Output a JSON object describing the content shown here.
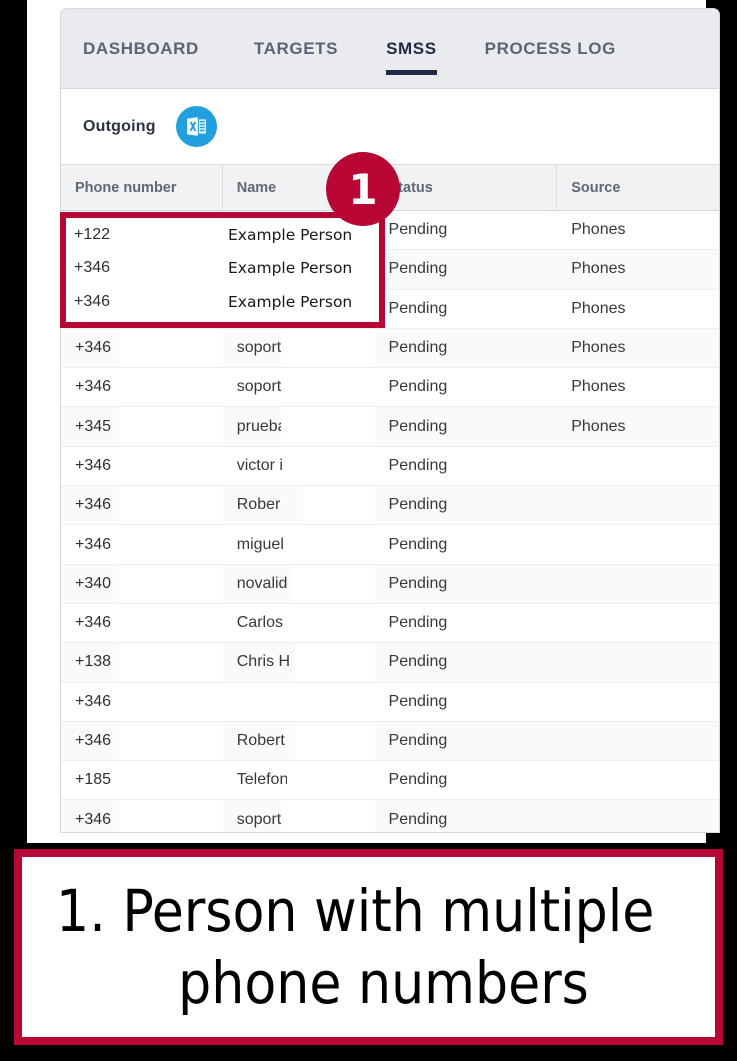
{
  "window": {
    "outer_background": "#000000",
    "page_background": "#ffffff",
    "accent_red": "#b80735",
    "excel_blue": "#21a0dd"
  },
  "tabs": [
    {
      "label": "DASHBOARD",
      "active": false
    },
    {
      "label": "TARGETS",
      "active": false
    },
    {
      "label": "SMSS",
      "active": true
    },
    {
      "label": "PROCESS LOG",
      "active": false
    }
  ],
  "toolbar": {
    "title": "Outgoing",
    "export_icon": "excel-export-icon"
  },
  "table": {
    "columns": [
      "Phone number",
      "Name",
      "Status",
      "Source"
    ],
    "rows": [
      {
        "phone": "+122",
        "name": "",
        "status": "Pending",
        "source": "Phones"
      },
      {
        "phone": "+346",
        "name": "",
        "status": "Pending",
        "source": "Phones"
      },
      {
        "phone": "+346",
        "name": "",
        "status": "Pending",
        "source": "Phones"
      },
      {
        "phone": "+346",
        "name": "soport",
        "status": "Pending",
        "source": "Phones"
      },
      {
        "phone": "+346",
        "name": "soport",
        "status": "Pending",
        "source": "Phones"
      },
      {
        "phone": "+345",
        "name": "prueba",
        "status": "Pending",
        "source": "Phones"
      },
      {
        "phone": "+346",
        "name": "victor i",
        "status": "Pending",
        "source": ""
      },
      {
        "phone": "+346",
        "name": "Rober",
        "status": "Pending",
        "source": ""
      },
      {
        "phone": "+346",
        "name": "miguel",
        "status": "Pending",
        "source": ""
      },
      {
        "phone": "+340",
        "name": "novalid",
        "status": "Pending",
        "source": ""
      },
      {
        "phone": "+346",
        "name": "Carlos",
        "status": "Pending",
        "source": ""
      },
      {
        "phone": "+138",
        "name": "Chris H",
        "status": "Pending",
        "source": ""
      },
      {
        "phone": "+346",
        "name": "",
        "status": "Pending",
        "source": ""
      },
      {
        "phone": "+346",
        "name": "Robert",
        "status": "Pending",
        "source": ""
      },
      {
        "phone": "+185",
        "name": "Telefon",
        "status": "Pending",
        "source": ""
      },
      {
        "phone": "+346",
        "name": "soport",
        "status": "Pending",
        "source": ""
      }
    ]
  },
  "annotation": {
    "badge_number": "1",
    "highlighted_rows": [
      {
        "phone": "+122",
        "name": "Example Person"
      },
      {
        "phone": "+346",
        "name": "Example Person"
      },
      {
        "phone": "+346",
        "name": "Example Person"
      }
    ],
    "caption_line_1": "1. Person with multiple",
    "caption_line_2": "phone numbers"
  }
}
